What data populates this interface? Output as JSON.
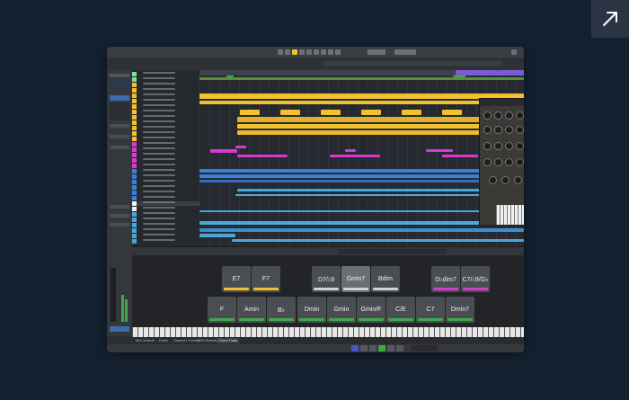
{
  "expand_icon": "diagonal-arrow-up-right-icon",
  "colors": {
    "background": "#14202f",
    "yellow": "#f2c12e",
    "magenta": "#d63bd0",
    "blue": "#3b7fd9",
    "cyan": "#4aa8d8",
    "green": "#3fa84a",
    "cycle": "#7a5bd6",
    "selection": "#22c3d8"
  },
  "bottom_tabs": [
    "MixConsole",
    "Editor",
    "Sampler Control",
    "MIDI Remote",
    "Chord Pads"
  ],
  "chord_pads": {
    "top_row": [
      {
        "label": "E7",
        "color": "#f2c12e"
      },
      {
        "label": "F7",
        "color": "#f2c12e"
      },
      {
        "label": "D7/♭9",
        "color": "#d0d2d6"
      },
      {
        "label": "Gmin7",
        "color": "#d0d2d6"
      },
      {
        "label": "Bdim",
        "color": "#d0d2d6"
      },
      {
        "label": "D♭dim7",
        "color": "#d63bd0"
      },
      {
        "label": "C7/♭9/G♭",
        "color": "#d63bd0"
      }
    ],
    "bottom_row": [
      {
        "label": "F",
        "color": "#3fa84a"
      },
      {
        "label": "Amin",
        "color": "#3fa84a"
      },
      {
        "label": "B♭",
        "color": "#3fa84a"
      },
      {
        "label": "Dmin",
        "color": "#3fa84a"
      },
      {
        "label": "Gmin",
        "color": "#3fa84a"
      },
      {
        "label": "Gmin/F",
        "color": "#3fa84a"
      },
      {
        "label": "C/E",
        "color": "#3fa84a"
      },
      {
        "label": "C7",
        "color": "#3fa84a"
      },
      {
        "label": "Dmin7",
        "color": "#3fa84a"
      }
    ]
  }
}
